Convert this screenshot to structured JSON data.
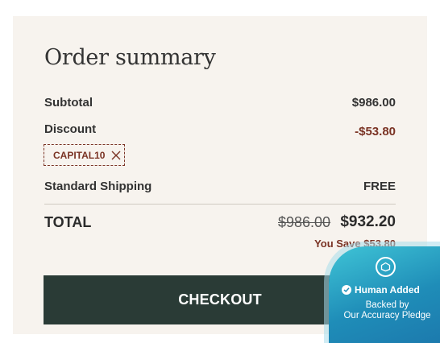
{
  "summary": {
    "title": "Order summary",
    "subtotal_label": "Subtotal",
    "subtotal_value": "$986.00",
    "discount_label": "Discount",
    "discount_value": "-$53.80",
    "coupon_code": "CAPITAL10",
    "shipping_label": "Standard Shipping",
    "shipping_value": "FREE",
    "total_label": "TOTAL",
    "total_original": "$986.00",
    "total_final": "$932.20",
    "savings_text": "You Save $53.80",
    "checkout_label": "CHECKOUT"
  },
  "badge": {
    "title": "Human Added",
    "line1": "Backed by",
    "line2": "Our Accuracy Pledge"
  },
  "colors": {
    "panel_bg": "#f7f3ee",
    "accent": "#7a3324",
    "checkout_bg": "#2a3b36",
    "badge_teal": "#2aa6c8"
  },
  "icons": {
    "coupon_remove": "close-icon",
    "badge_logo": "pledge-icon",
    "badge_check": "check-circle-icon"
  }
}
